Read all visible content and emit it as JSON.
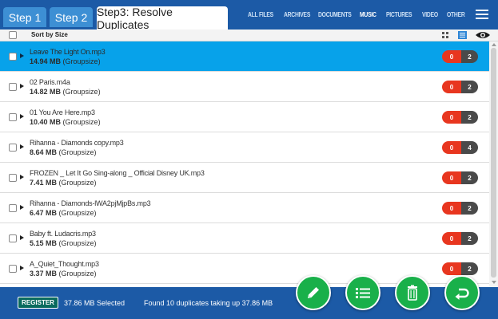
{
  "header": {
    "steps": [
      {
        "label": "Step 1",
        "active": false
      },
      {
        "label": "Step 2",
        "active": false
      },
      {
        "label": "Step3:  Resolve Duplicates",
        "active": true
      }
    ],
    "nav": [
      {
        "label": "ALL FILES",
        "active": false
      },
      {
        "label": "ARCHIVES",
        "active": false
      },
      {
        "label": "DOCUMENTS",
        "active": false
      },
      {
        "label": "MUSIC",
        "active": true
      },
      {
        "label": "PICTURES",
        "active": false
      },
      {
        "label": "VIDEO",
        "active": false
      },
      {
        "label": "OTHER",
        "active": false
      }
    ],
    "menu_icon": "hamburger-menu-icon"
  },
  "toolbar": {
    "sort_label": "Sort by Size",
    "view_icons": [
      "grid-view-icon",
      "list-view-icon",
      "eye-icon"
    ]
  },
  "files": [
    {
      "name": "Leave The Light On.mp3",
      "size": "14.94 MB",
      "size_note": "(Groupsize)",
      "badge_left": "0",
      "badge_right": "2",
      "selected": true
    },
    {
      "name": "02 Paris.m4a",
      "size": "14.82 MB",
      "size_note": "(Groupsize)",
      "badge_left": "0",
      "badge_right": "2",
      "selected": false
    },
    {
      "name": "01 You Are Here.mp3",
      "size": "10.40 MB",
      "size_note": "(Groupsize)",
      "badge_left": "0",
      "badge_right": "2",
      "selected": false
    },
    {
      "name": "Rihanna - Diamonds copy.mp3",
      "size": "8.64 MB",
      "size_note": "(Groupsize)",
      "badge_left": "0",
      "badge_right": "4",
      "selected": false
    },
    {
      "name": "FROZEN _ Let It Go Sing-along _ Official Disney UK.mp3",
      "size": "7.41 MB",
      "size_note": "(Groupsize)",
      "badge_left": "0",
      "badge_right": "2",
      "selected": false
    },
    {
      "name": "Rihanna - Diamonds-lWA2pjMjpBs.mp3",
      "size": "6.47 MB",
      "size_note": "(Groupsize)",
      "badge_left": "0",
      "badge_right": "2",
      "selected": false
    },
    {
      "name": "Baby ft. Ludacris.mp3",
      "size": "5.15 MB",
      "size_note": "(Groupsize)",
      "badge_left": "0",
      "badge_right": "2",
      "selected": false
    },
    {
      "name": "A_Quiet_Thought.mp3",
      "size": "3.37 MB",
      "size_note": "(Groupsize)",
      "badge_left": "0",
      "badge_right": "2",
      "selected": false
    }
  ],
  "footer": {
    "register_label": "REGISTER",
    "selected_text": "37.86 MB Selected",
    "found_text": "Found  10  duplicates taking up  37.86  MB",
    "actions": [
      "pencil-icon",
      "list-icon",
      "trash-icon",
      "undo-icon"
    ]
  },
  "colors": {
    "header_bg": "#1c5aa6",
    "selected_row": "#07a2ea",
    "badge_red": "#e8361f",
    "badge_dark": "#4a4a4a",
    "fab_green": "#19b04a",
    "register_bg": "#0a6a5e"
  }
}
